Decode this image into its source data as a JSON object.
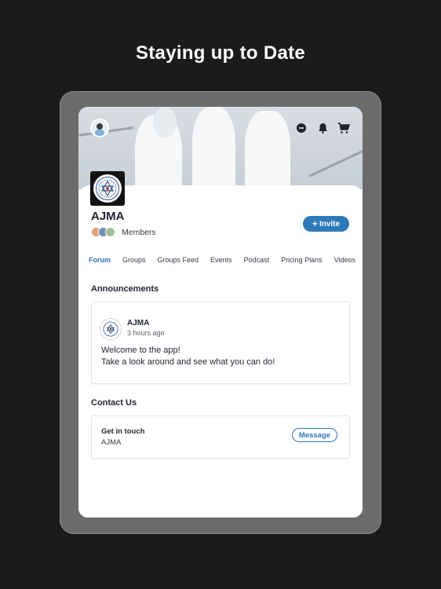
{
  "headline": "Staying up to Date",
  "group": {
    "name": "AJMA",
    "members_label": "Members",
    "invite_plus": "+",
    "invite_label": "Invite"
  },
  "header_icons": [
    "chat-icon",
    "bell-icon",
    "cart-icon"
  ],
  "tabs": [
    {
      "label": "Forum",
      "active": true
    },
    {
      "label": "Groups",
      "active": false
    },
    {
      "label": "Groups Feed",
      "active": false
    },
    {
      "label": "Events",
      "active": false
    },
    {
      "label": "Podcast",
      "active": false
    },
    {
      "label": "Pricing Plans",
      "active": false
    },
    {
      "label": "Videos",
      "active": false
    }
  ],
  "announcements": {
    "title": "Announcements",
    "post": {
      "author": "AJMA",
      "time": "3 hours ago",
      "line1": "Welcome to the app!",
      "line2": "Take a look around and see what you can do!"
    }
  },
  "contact": {
    "title": "Contact Us",
    "label": "Get in touch",
    "name": "AJMA",
    "button": "Message"
  },
  "colors": {
    "accent": "#2e79b8",
    "background": "#1b1b1b",
    "device_frame": "#6b6b6b"
  }
}
